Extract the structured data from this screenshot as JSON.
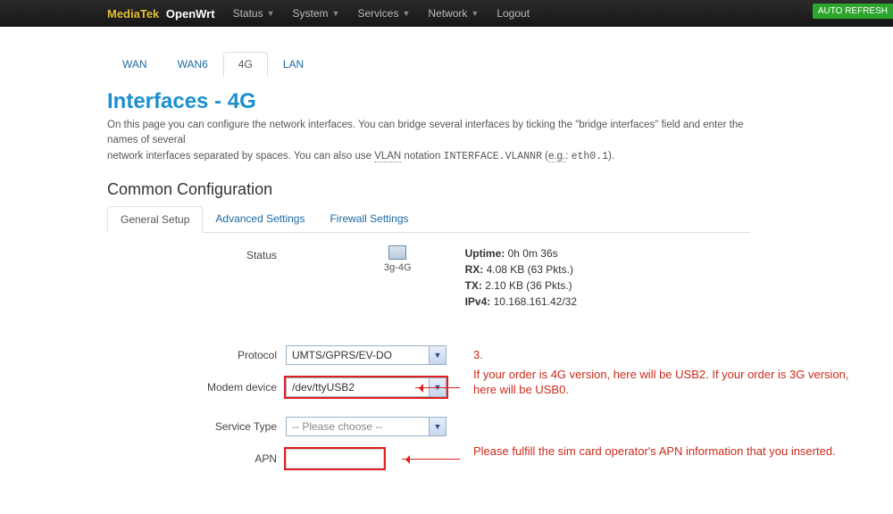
{
  "brand": {
    "mtk": "MediaTek",
    "owr": "OpenWrt"
  },
  "nav": {
    "status": "Status",
    "system": "System",
    "services": "Services",
    "network": "Network",
    "logout": "Logout"
  },
  "auto_refresh": "AUTO REFRESH",
  "iface_tabs": {
    "wan": "WAN",
    "wan6": "WAN6",
    "f4g": "4G",
    "lan": "LAN"
  },
  "page_title": "Interfaces - 4G",
  "desc": {
    "line_a": "On this page you can configure the network interfaces. You can bridge several interfaces by ticking the \"bridge interfaces\" field and enter the names of several",
    "line_b_pre": "network interfaces separated by spaces. You can also use ",
    "vlan": "VLAN",
    "line_b_mid": " notation ",
    "mono1": "INTERFACE.VLANNR",
    "line_b_mid2": " (",
    "eg": "e.g.",
    "line_b_mid3": ": ",
    "mono2": "eth0.1",
    "line_b_end": ")."
  },
  "section_title": "Common Configuration",
  "cfg_tabs": {
    "general": "General Setup",
    "advanced": "Advanced Settings",
    "firewall": "Firewall Settings"
  },
  "labels": {
    "status": "Status",
    "protocol": "Protocol",
    "modem": "Modem device",
    "service": "Service Type",
    "apn": "APN"
  },
  "status": {
    "iface": "3g-4G",
    "uptime_k": "Uptime:",
    "uptime_v": "0h 0m 36s",
    "rx_k": "RX:",
    "rx_v": "4.08 KB (63 Pkts.)",
    "tx_k": "TX:",
    "tx_v": "2.10 KB (36 Pkts.)",
    "ip_k": "IPv4:",
    "ip_v": "10.168.161.42/32"
  },
  "protocol_value": "UMTS/GPRS/EV-DO",
  "modem_value": "/dev/ttyUSB2",
  "service_value": "-- Please choose --",
  "apn_value": "",
  "annot": {
    "n3": "3.",
    "modem": "If your order is 4G version, here will be USB2. If your order is 3G version, here will be USB0.",
    "apn": "Please fulfill the sim card operator's APN information that you inserted."
  }
}
